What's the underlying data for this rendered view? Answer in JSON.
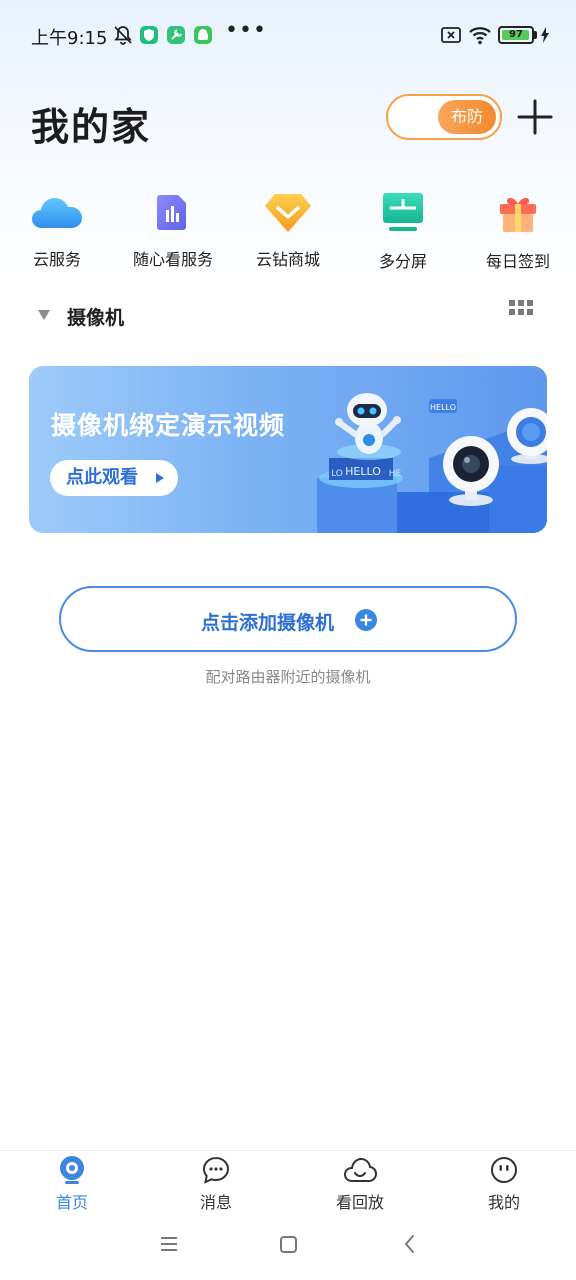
{
  "status_bar": {
    "time": "上午9:15",
    "battery": "97",
    "battery_level": 0.97,
    "icons": [
      "mute-bell-icon",
      "shield-app-icon",
      "tools-app-icon",
      "android-app-icon",
      "more-dots-icon",
      "sim-off-icon",
      "wifi-icon",
      "battery-icon",
      "charging-icon"
    ]
  },
  "header": {
    "title": "我的家",
    "arm_toggle_label": "布防",
    "add_icon": "plus-icon"
  },
  "quick_actions": [
    {
      "label": "云服务",
      "icon": "cloud-icon"
    },
    {
      "label": "随心看服务",
      "icon": "chart-doc-icon"
    },
    {
      "label": "云钻商城",
      "icon": "diamond-icon"
    },
    {
      "label": "多分屏",
      "icon": "split-screen-icon"
    },
    {
      "label": "每日签到",
      "icon": "gift-icon"
    }
  ],
  "section": {
    "title": "摄像机",
    "view_toggle_icon": "grid-view-icon"
  },
  "banner": {
    "title": "摄像机绑定演示视频",
    "button_label": "点此观看",
    "art_texts": [
      "HELLO",
      "HELLO",
      "LO",
      "HE"
    ]
  },
  "add_camera": {
    "label": "点击添加摄像机",
    "hint": "配对路由器附近的摄像机"
  },
  "bottom_nav": [
    {
      "label": "首页",
      "icon": "home-camera-icon",
      "active": true
    },
    {
      "label": "消息",
      "icon": "message-icon",
      "active": false
    },
    {
      "label": "看回放",
      "icon": "cloud-playback-icon",
      "active": false
    },
    {
      "label": "我的",
      "icon": "profile-icon",
      "active": false
    }
  ],
  "colors": {
    "accent_blue": "#3b86e0",
    "toggle_orange": "#f28a2e",
    "banner_blue": "#7eb4f5"
  }
}
